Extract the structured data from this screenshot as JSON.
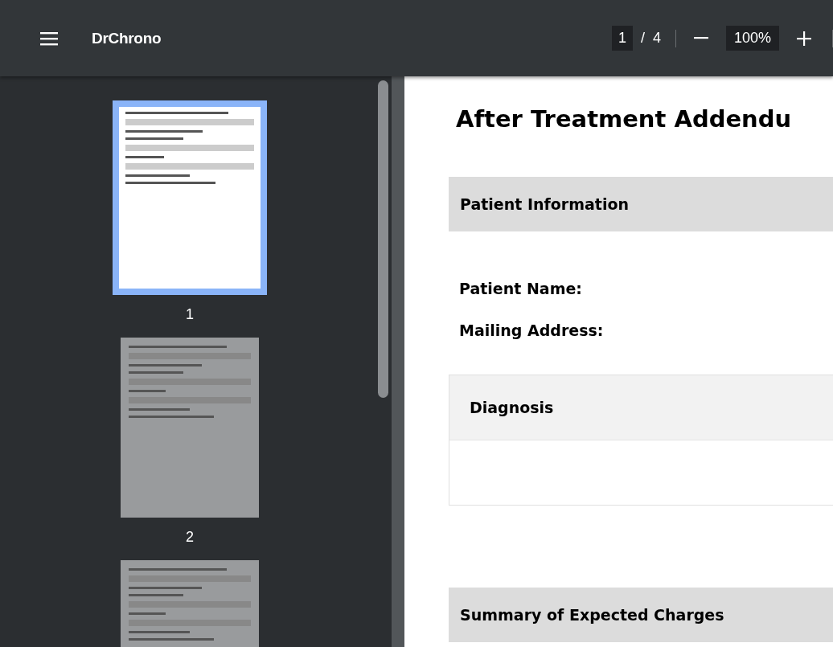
{
  "toolbar": {
    "title": "DrChrono",
    "page_current": "1",
    "page_separator": "/",
    "page_total": "4",
    "zoom": "100%"
  },
  "thumbnails": [
    {
      "label": "1",
      "selected": true
    },
    {
      "label": "2",
      "selected": false
    },
    {
      "selected": false
    }
  ],
  "document": {
    "title": "After Treatment Addendu",
    "sections": [
      {
        "kind": "bar",
        "heading": "Patient Information"
      },
      {
        "kind": "fields",
        "labels": [
          "Patient Name:",
          "Mailing Address:"
        ]
      },
      {
        "kind": "box",
        "heading": "Diagnosis"
      },
      {
        "kind": "bar",
        "heading": "Summary of Expected Charges"
      }
    ]
  }
}
